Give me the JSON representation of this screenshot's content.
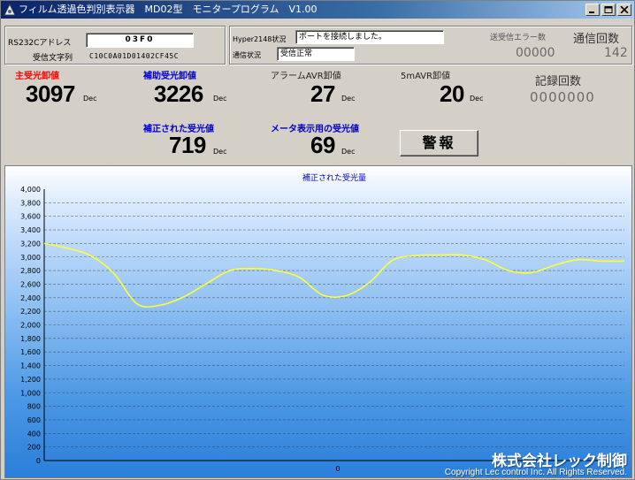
{
  "window": {
    "title": "フィルム透過色判別表示器　MD02型　モニタープログラム　V1.00"
  },
  "comm": {
    "rs232c_label": "RS232Cアドレス",
    "rs232c_value": "03F0",
    "recv_string_label": "受信文字列",
    "recv_string_value": "C10C0A01D01402CF45C",
    "hyper_label": "Hyper2148状況",
    "hyper_value": "ポートを接続しました。",
    "comm_status_label": "通信状況",
    "comm_status_value": "受信正常",
    "error_count_label": "送受信エラー数",
    "error_count_value": "00000",
    "comm_count_label": "通信回数",
    "comm_count_value": "142"
  },
  "readings": {
    "main_label": "主受光卸値",
    "main_value": "3097",
    "aux_label": "補助受光卸値",
    "aux_value": "3226",
    "alarm_avr_label": "アラームAVR卸値",
    "alarm_avr_value": "27",
    "five_avr_label": "5mAVR卸値",
    "five_avr_value": "20",
    "record_count_label": "記録回数",
    "record_count_value": "0000000",
    "corrected_label": "補正された受光値",
    "corrected_value": "719",
    "meter_label": "メータ表示用の受光値",
    "meter_value": "69",
    "unit": "Dec"
  },
  "alarm_button": "警報",
  "colors": {
    "main_label": "#ff0000",
    "aux_label": "#0000cc",
    "line": "#ffff33"
  },
  "chart_data": {
    "type": "line",
    "title": "補正された受光量",
    "xlabel": "",
    "ylabel": "",
    "x_tick_labels": [
      "0"
    ],
    "ylim": [
      0,
      4000
    ],
    "yticks": [
      "4,000",
      "3,800",
      "3,600",
      "3,400",
      "3,200",
      "3,000",
      "2,800",
      "2,600",
      "2,400",
      "2,200",
      "2,000",
      "1,800",
      "1,600",
      "1,400",
      "1,200",
      "1,000",
      "800",
      "600",
      "400",
      "200",
      "0"
    ],
    "grid": true,
    "series": [
      {
        "x": [
          0,
          4,
          8,
          12,
          16,
          20,
          24,
          28,
          32,
          36,
          40,
          44,
          48,
          52,
          56,
          60,
          64,
          68,
          72,
          76,
          80,
          84,
          88,
          92,
          96,
          100
        ],
        "values": [
          3200,
          3130,
          3020,
          2760,
          2310,
          2290,
          2410,
          2610,
          2800,
          2830,
          2800,
          2700,
          2440,
          2430,
          2620,
          2950,
          3020,
          3030,
          3030,
          2960,
          2800,
          2770,
          2880,
          2960,
          2940,
          2940
        ]
      }
    ]
  },
  "footer": {
    "company": "株式会社レック制御",
    "copyright": "Copyright Lec control Inc. All Rights Reserved."
  }
}
